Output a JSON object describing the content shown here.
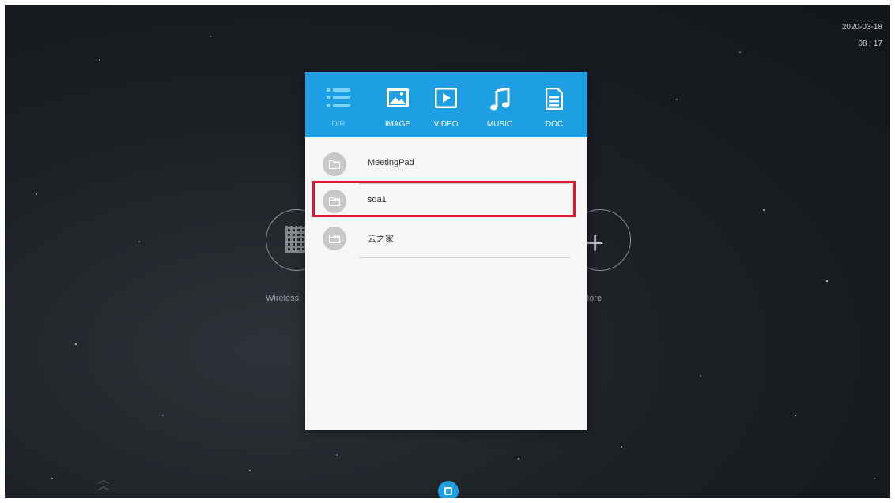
{
  "status": {
    "date": "2020-03-18",
    "time": "08 : 17"
  },
  "background": {
    "left_label": "Wireless",
    "right_label": "More"
  },
  "tabs": [
    {
      "label": "DIR",
      "icon": "list-icon",
      "active": true
    },
    {
      "label": "IMAGE",
      "icon": "image-icon",
      "active": false
    },
    {
      "label": "VIDEO",
      "icon": "play-icon",
      "active": false
    },
    {
      "label": "MUSIC",
      "icon": "music-note-icon",
      "active": false
    },
    {
      "label": "DOC",
      "icon": "document-icon",
      "active": false
    }
  ],
  "items": [
    {
      "name": "MeetingPad",
      "icon": "folder-icon"
    },
    {
      "name": "sda1",
      "icon": "folder-icon",
      "highlighted": true
    },
    {
      "name": "云之家",
      "icon": "folder-icon"
    }
  ],
  "colors": {
    "accent": "#1e9fe3",
    "highlight": "#e0182f",
    "dialog_bg": "#f6f6f6"
  }
}
